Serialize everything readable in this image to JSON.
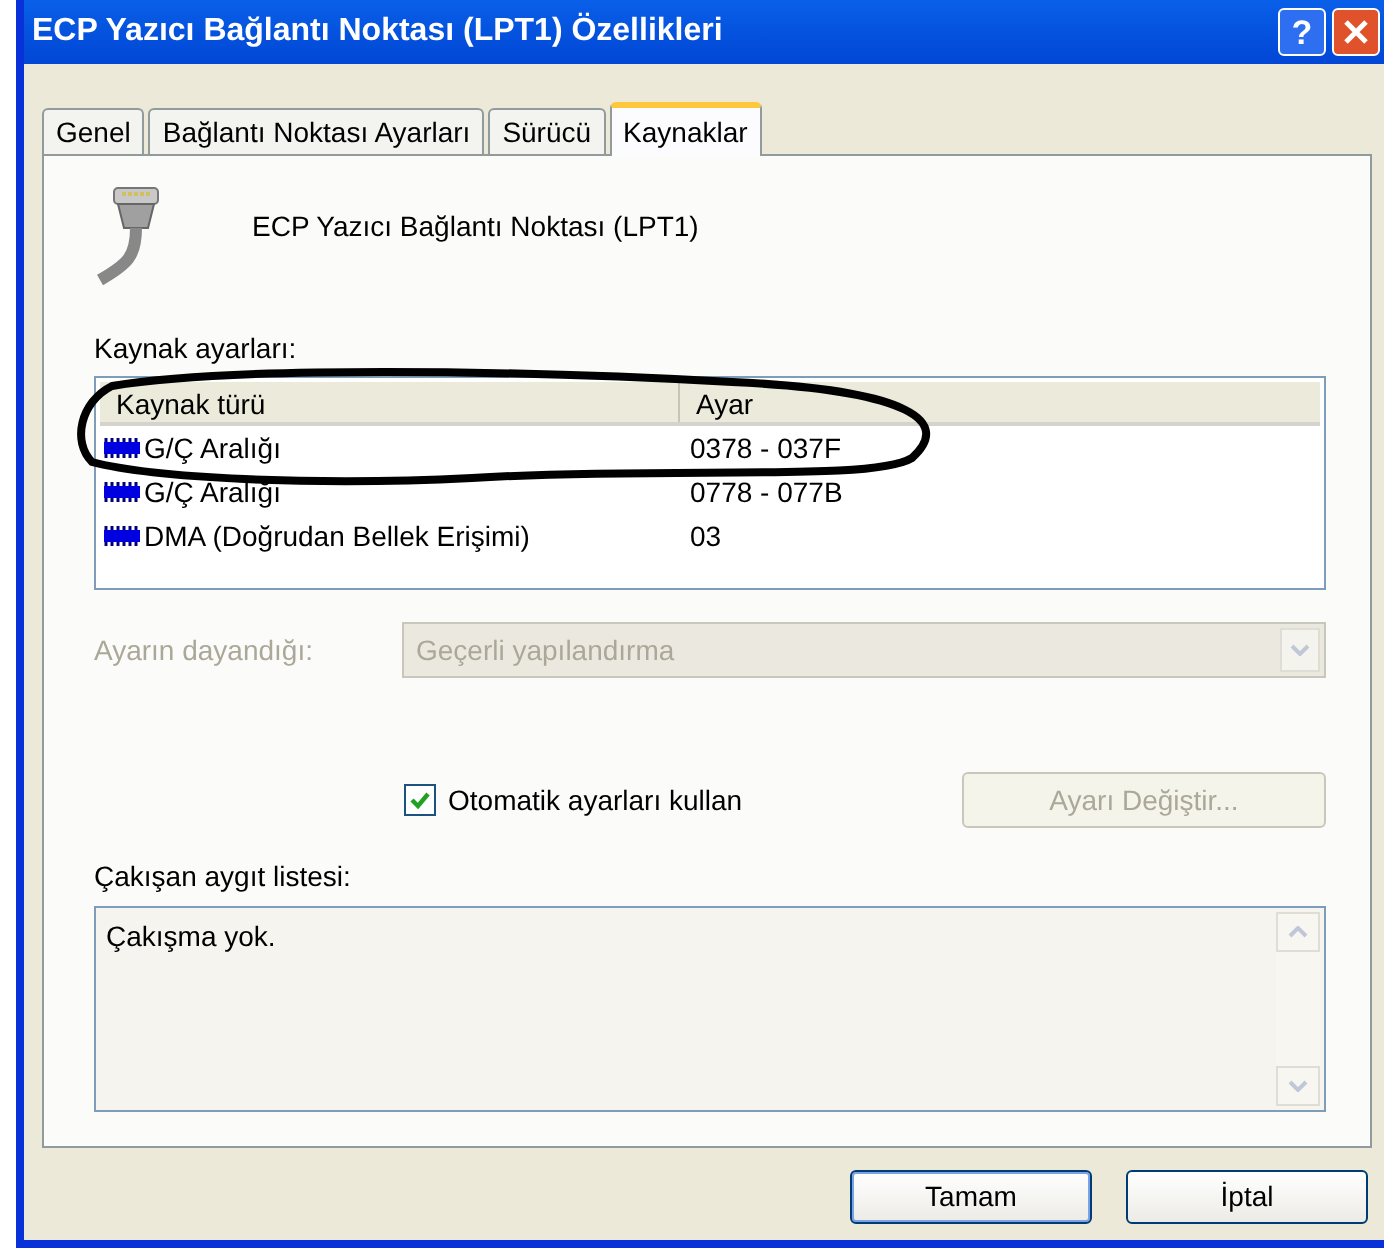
{
  "window": {
    "title": "ECP Yazıcı Bağlantı Noktası (LPT1) Özellikleri",
    "help_button": "?"
  },
  "tabs": [
    {
      "label": "Genel",
      "selected": false
    },
    {
      "label": "Bağlantı Noktası Ayarları",
      "selected": false
    },
    {
      "label": "Sürücü",
      "selected": false
    },
    {
      "label": "Kaynaklar",
      "selected": true
    }
  ],
  "device_name": "ECP Yazıcı Bağlantı Noktası (LPT1)",
  "resources": {
    "label": "Kaynak ayarları:",
    "columns": [
      "Kaynak türü",
      "Ayar"
    ],
    "rows": [
      {
        "type": "G/Ç Aralığı",
        "setting": "0378 - 037F"
      },
      {
        "type": "G/Ç Aralığı",
        "setting": "0778 - 077B"
      },
      {
        "type": "DMA (Doğrudan Bellek Erişimi)",
        "setting": "03"
      }
    ]
  },
  "based_on": {
    "label": "Ayarın dayandığı:",
    "value": "Geçerli yapılandırma",
    "disabled": true
  },
  "auto_settings": {
    "label": "Otomatik ayarları kullan",
    "checked": true
  },
  "change_button": {
    "label": "Ayarı Değiştir...",
    "disabled": true
  },
  "conflicts": {
    "label": "Çakışan aygıt listesi:",
    "text": "Çakışma yok."
  },
  "buttons": [
    "Tamam",
    "İptal"
  ]
}
